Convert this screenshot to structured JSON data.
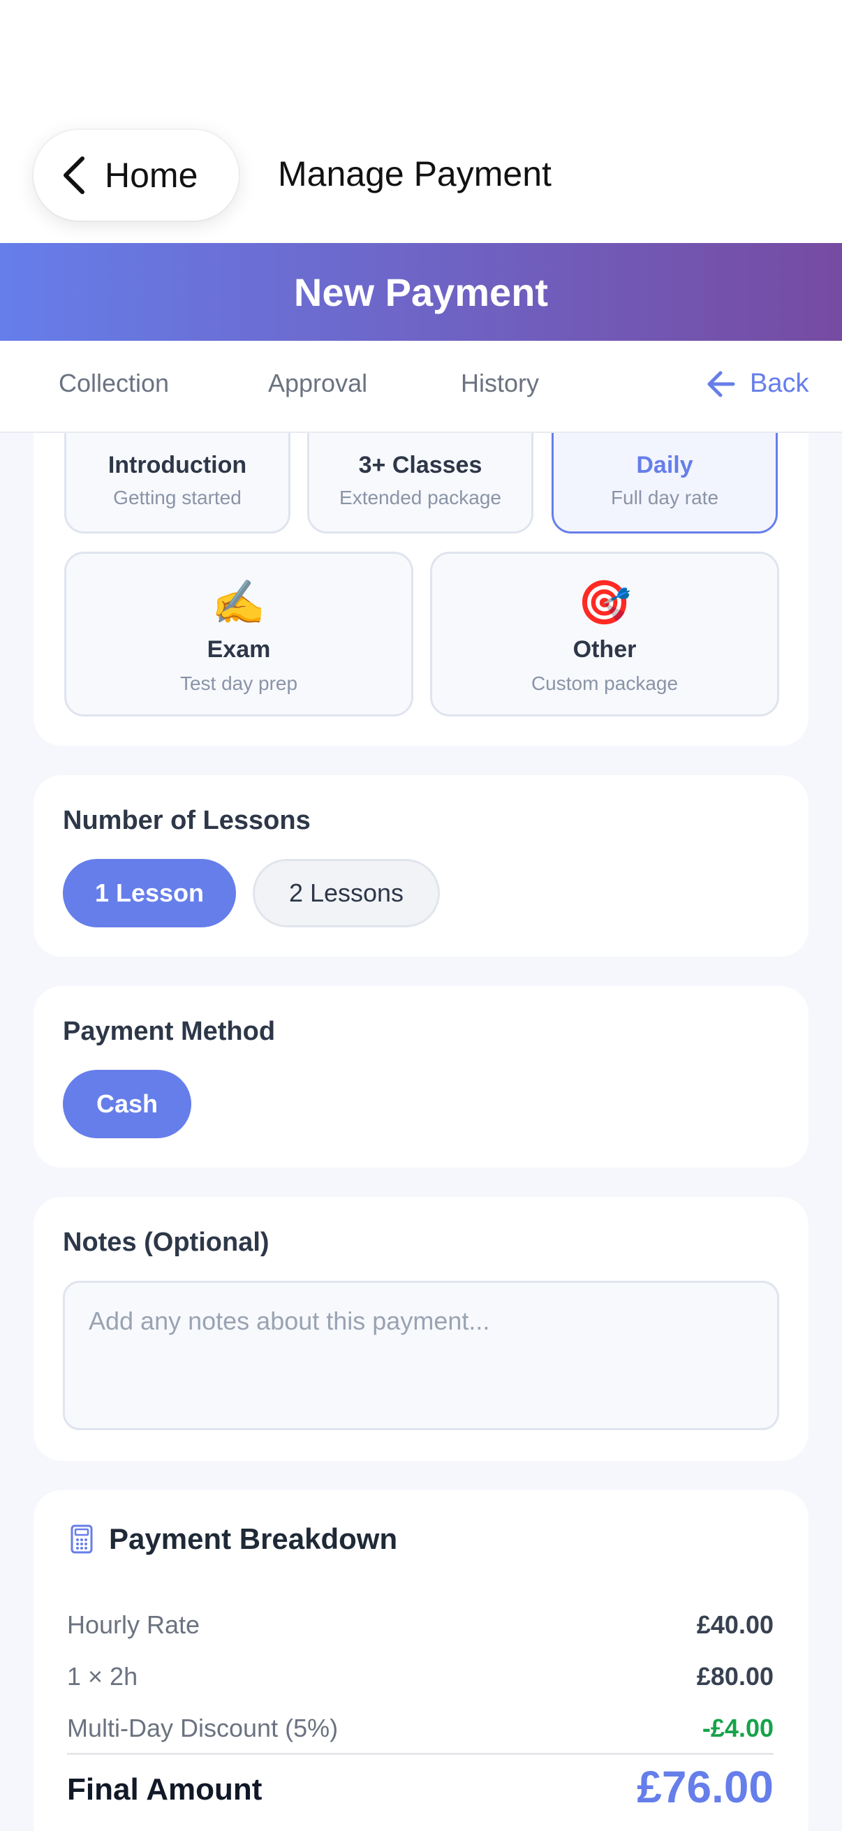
{
  "nav": {
    "back_label": "Home",
    "title": "Manage Payment"
  },
  "header": {
    "title": "New Payment",
    "gradient_from": "#667eea",
    "gradient_to": "#764ba2"
  },
  "tabs": [
    {
      "label": "Collection"
    },
    {
      "label": "Approval"
    },
    {
      "label": "History"
    }
  ],
  "back_link": {
    "label": "Back",
    "icon": "arrow-left-icon"
  },
  "packages": [
    {
      "name": "Introduction",
      "desc": "Getting started",
      "emoji": "🚦",
      "selected": false
    },
    {
      "name": "3+ Classes",
      "desc": "Extended package",
      "emoji": "⏰",
      "selected": false
    },
    {
      "name": "Daily",
      "desc": "Full day rate",
      "emoji": "📅",
      "selected": true
    },
    {
      "name": "Exam",
      "desc": "Test day prep",
      "emoji": "✍️",
      "selected": false
    },
    {
      "name": "Other",
      "desc": "Custom package",
      "emoji": "🎯",
      "selected": false
    }
  ],
  "lessons": {
    "label": "Number of Lessons",
    "options": [
      "1 Lesson",
      "2 Lessons"
    ],
    "selected": "1 Lesson"
  },
  "payment_method": {
    "label": "Payment Method",
    "options": [
      "Cash"
    ],
    "selected": "Cash"
  },
  "notes": {
    "label": "Notes (Optional)",
    "placeholder": "Add any notes about this payment...",
    "value": ""
  },
  "breakdown": {
    "title": "Payment Breakdown",
    "icon": "calculator-icon",
    "rows": [
      {
        "label": "Hourly Rate",
        "value": "£40.00"
      },
      {
        "label": "1 × 2h",
        "value": "£80.00"
      },
      {
        "label": "Multi-Day Discount (5%)",
        "value": "-£4.00"
      }
    ],
    "final_label": "Final Amount",
    "final_value": "£76.00"
  },
  "colors": {
    "accent": "#667eea",
    "discount": "#16a34a"
  }
}
